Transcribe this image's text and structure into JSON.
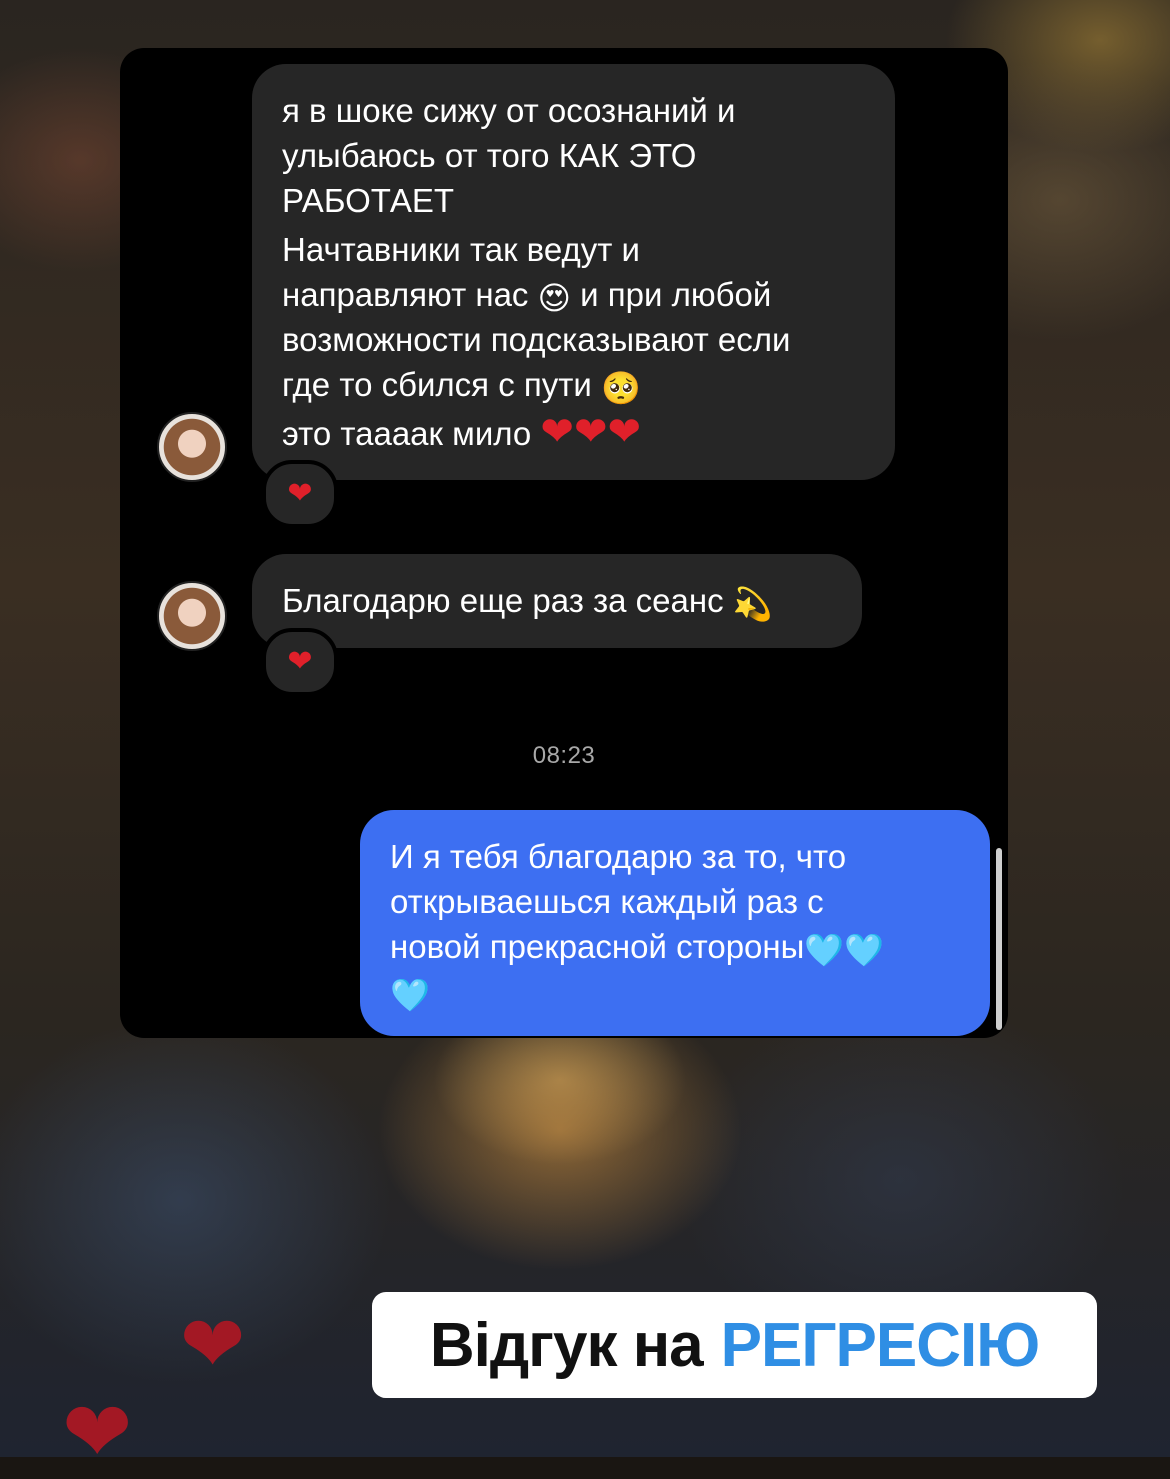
{
  "messages": {
    "first": {
      "lines": [
        "я в шоке сижу от осознаний и",
        "улыбаюсь от того КАК ЭТО",
        "РАБОТАЕТ",
        "Начтавники так ведут и",
        "направляют нас",
        "и при любой",
        "возможности подсказывают если",
        "где то сбился с пути",
        "это тааaак мило"
      ],
      "reaction": "❤"
    },
    "second": {
      "text": "Благодарю еще раз за сеанс",
      "reaction": "❤"
    },
    "timestamp": "08:23",
    "reply": {
      "lines": [
        "И я тебя благодарю за то, что",
        "открываешься каждый раз с",
        "новой прекрасной стороны"
      ]
    }
  },
  "emojis": {
    "heart_eyes": "😍",
    "pleading": "🥺",
    "red_heart": "❤",
    "dizzy": "💫",
    "blue_heart": "🩵"
  },
  "caption": {
    "part1": "Відгук на",
    "part2": "РЕГРЕСІЮ"
  },
  "colors": {
    "incoming_bubble": "#262626",
    "outgoing_bubble": "#3d6ff2",
    "caption_accent": "#2f8ee4"
  }
}
